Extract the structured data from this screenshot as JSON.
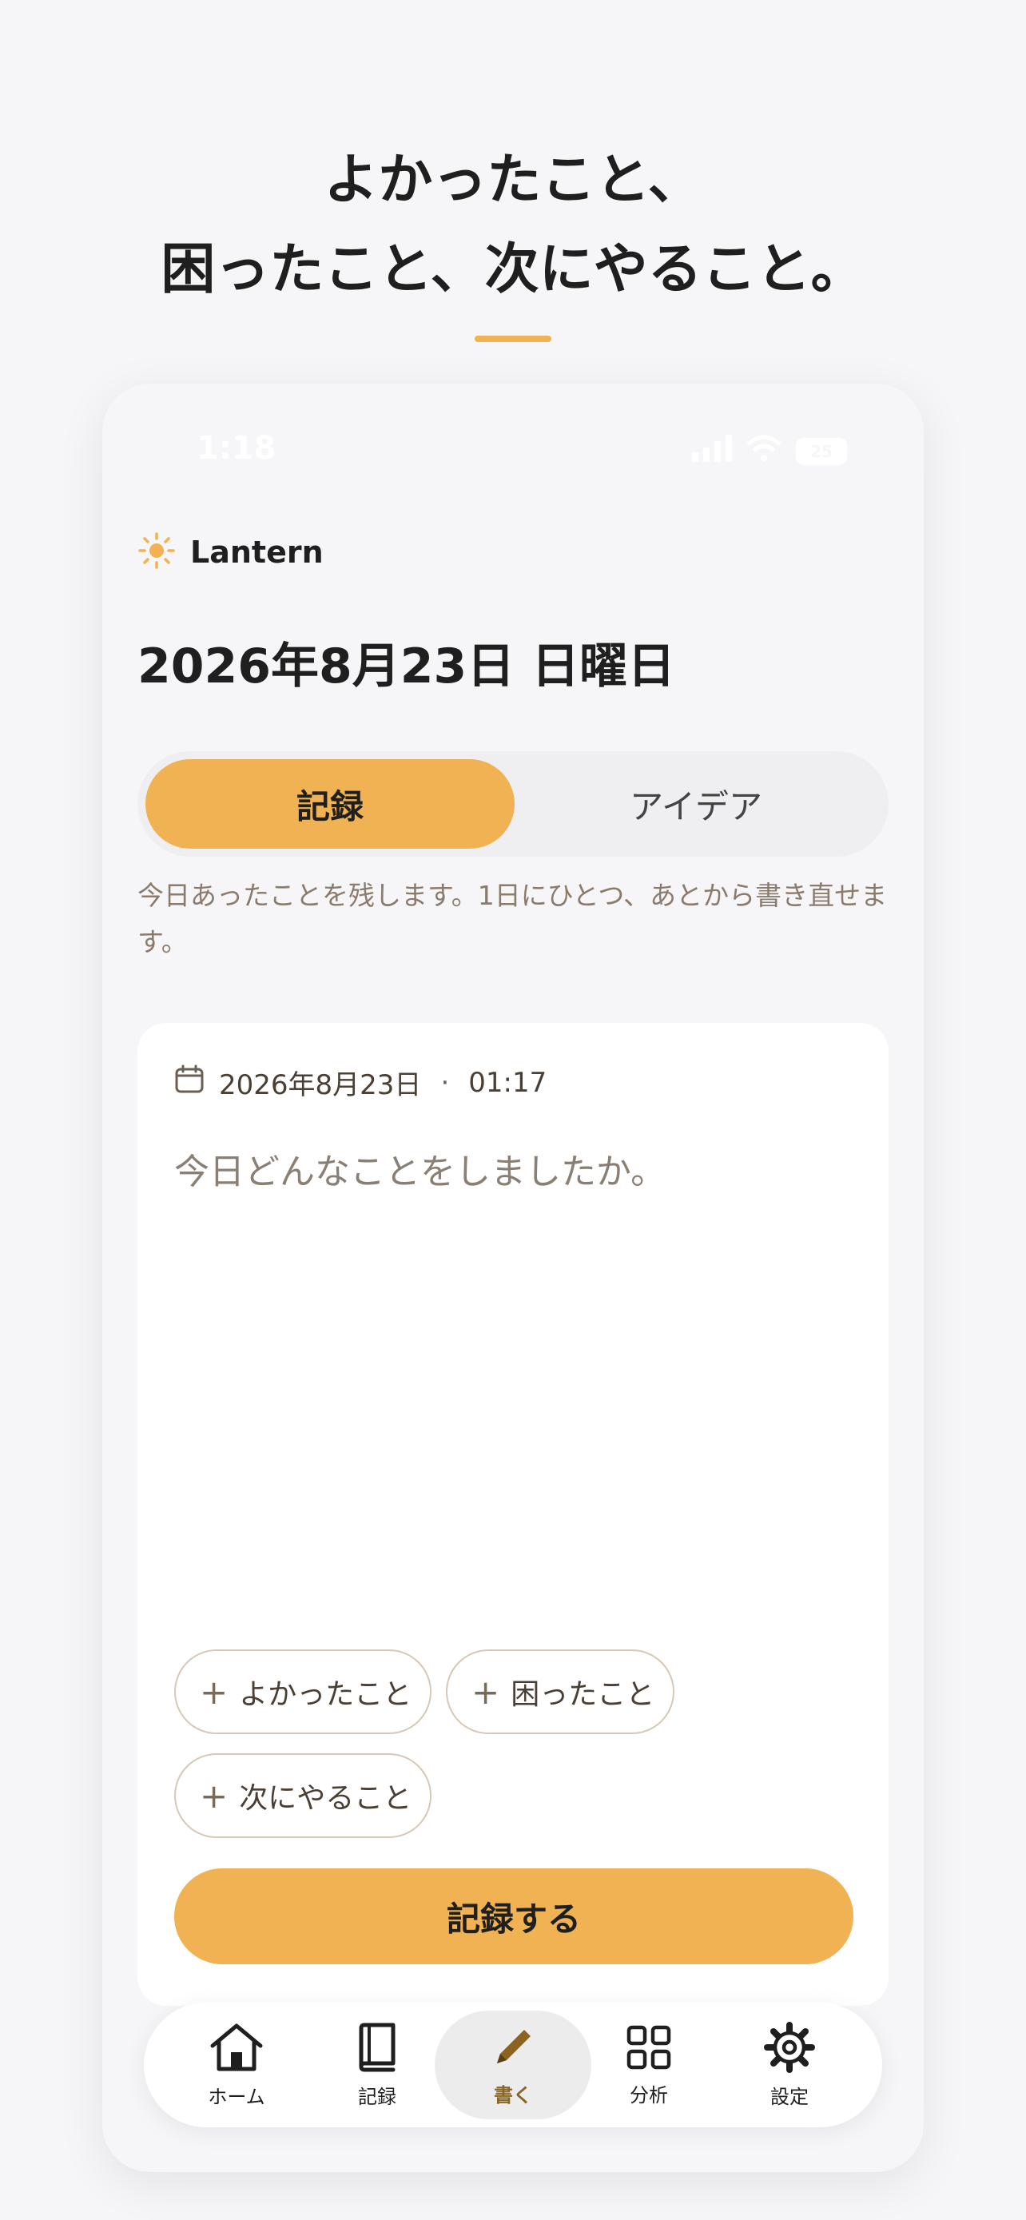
{
  "headline": {
    "line1": "よかったこと、",
    "line2": "困ったこと、次にやること。"
  },
  "status_bar": {
    "time": "1:18",
    "battery": "25"
  },
  "app": {
    "name": "Lantern",
    "date_title": "2026年8月23日 日曜日"
  },
  "segments": {
    "record": "記録",
    "ideas": "アイデア"
  },
  "description": "今日あったことを残します。1日にひとつ、あとから書き直せます。",
  "entry": {
    "date": "2026年8月23日",
    "separator": "·",
    "time": "01:17",
    "placeholder": "今日どんなことをしましたか。"
  },
  "chips": [
    {
      "label": "よかったこと"
    },
    {
      "label": "困ったこと"
    },
    {
      "label": "次にやること"
    }
  ],
  "submit_label": "記録する",
  "tabs": [
    {
      "label": "ホーム",
      "icon": "home-icon"
    },
    {
      "label": "記録",
      "icon": "book-icon"
    },
    {
      "label": "書く",
      "icon": "pencil-icon"
    },
    {
      "label": "分析",
      "icon": "grid-icon"
    },
    {
      "label": "設定",
      "icon": "gear-icon"
    }
  ],
  "colors": {
    "accent": "#f0b252",
    "background": "#f6f6f8",
    "card": "#ffffff",
    "muted_text": "#8a7b6c",
    "active_tab_label": "#8a6420"
  }
}
